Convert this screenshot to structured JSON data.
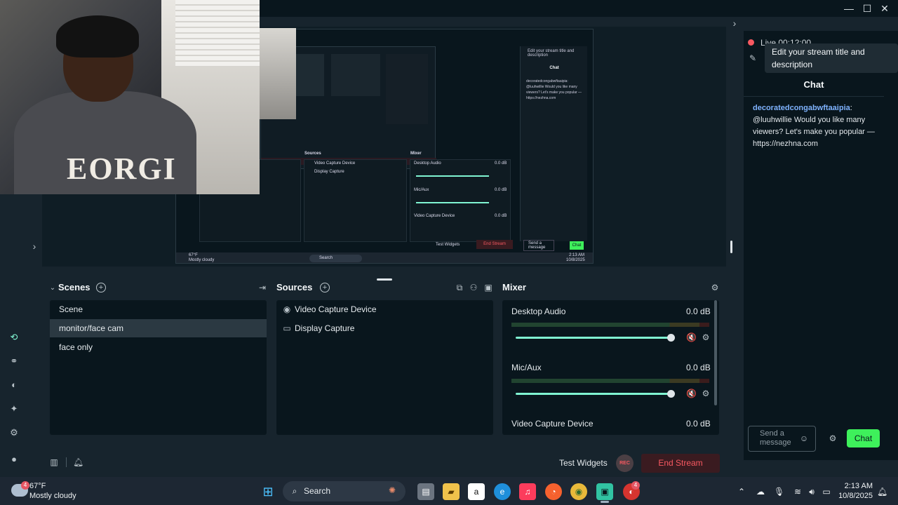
{
  "preview_screen": {
    "chat_tooltip": "Edit your stream title and description",
    "chat_title": "Chat",
    "chat_message": "decoratedcongabwftaaipia: @luuhwillie Would you like many viewers? Let's make you popular — https://nezhna.com",
    "sources_title": "Sources",
    "mixer_title": "Mixer",
    "source_items": [
      "Video Capture Device",
      "Display Capture"
    ],
    "mixer_items": [
      {
        "name": "Desktop Audio",
        "db": "0.0 dB"
      },
      {
        "name": "Mic/Aux",
        "db": "0.0 dB"
      },
      {
        "name": "Video Capture Device",
        "db": "0.0 dB"
      }
    ],
    "send_placeholder": "Send a message",
    "chat_button": "Chat",
    "test_widgets": "Test Widgets",
    "end_stream": "End Stream",
    "weather_temp": "67°F",
    "weather_desc": "Mostly cloudy",
    "search": "Search",
    "time": "2:13 AM",
    "date": "10/8/2025"
  },
  "webcam": {
    "shirt_text": "EORGI"
  },
  "right_panel": {
    "live_text": "Live 00:12:00",
    "tooltip": "Edit your stream title and description",
    "chat_title": "Chat",
    "message_user": "decoratedcongabwftaaipia",
    "message_text": ": @luuhwillie Would you like many viewers? Let's make you popular — https://nezhna.com",
    "input_placeholder": "Send a message",
    "send_label": "Chat"
  },
  "scenes": {
    "title": "Scenes",
    "items": [
      {
        "label": "Scene",
        "active": false
      },
      {
        "label": "monitor/face cam",
        "active": true
      },
      {
        "label": "face only",
        "active": false
      }
    ]
  },
  "sources": {
    "title": "Sources",
    "items": [
      {
        "label": "Video Capture Device",
        "icon": "webcam-icon"
      },
      {
        "label": "Display Capture",
        "icon": "monitor-icon"
      }
    ]
  },
  "mixer": {
    "title": "Mixer",
    "channels": [
      {
        "name": "Desktop Audio",
        "db": "0.0 dB",
        "volume": 1.0
      },
      {
        "name": "Mic/Aux",
        "db": "0.0 dB",
        "volume": 1.0
      },
      {
        "name": "Video Capture Device",
        "db": "0.0 dB"
      }
    ]
  },
  "footer": {
    "test_widgets": "Test Widgets",
    "rec_label": "REC",
    "end_stream": "End Stream"
  },
  "taskbar": {
    "weather_badge": "4",
    "weather_temp": "67°F",
    "weather_desc": "Mostly cloudy",
    "search_label": "Search",
    "app_badge": "4",
    "time": "2:13 AM",
    "date": "10/8/2025"
  },
  "colors": {
    "accent": "#80f5d2",
    "chat_button": "#3ef05b",
    "danger": "#f85961",
    "background": "#17242d",
    "panel": "#09161d"
  }
}
